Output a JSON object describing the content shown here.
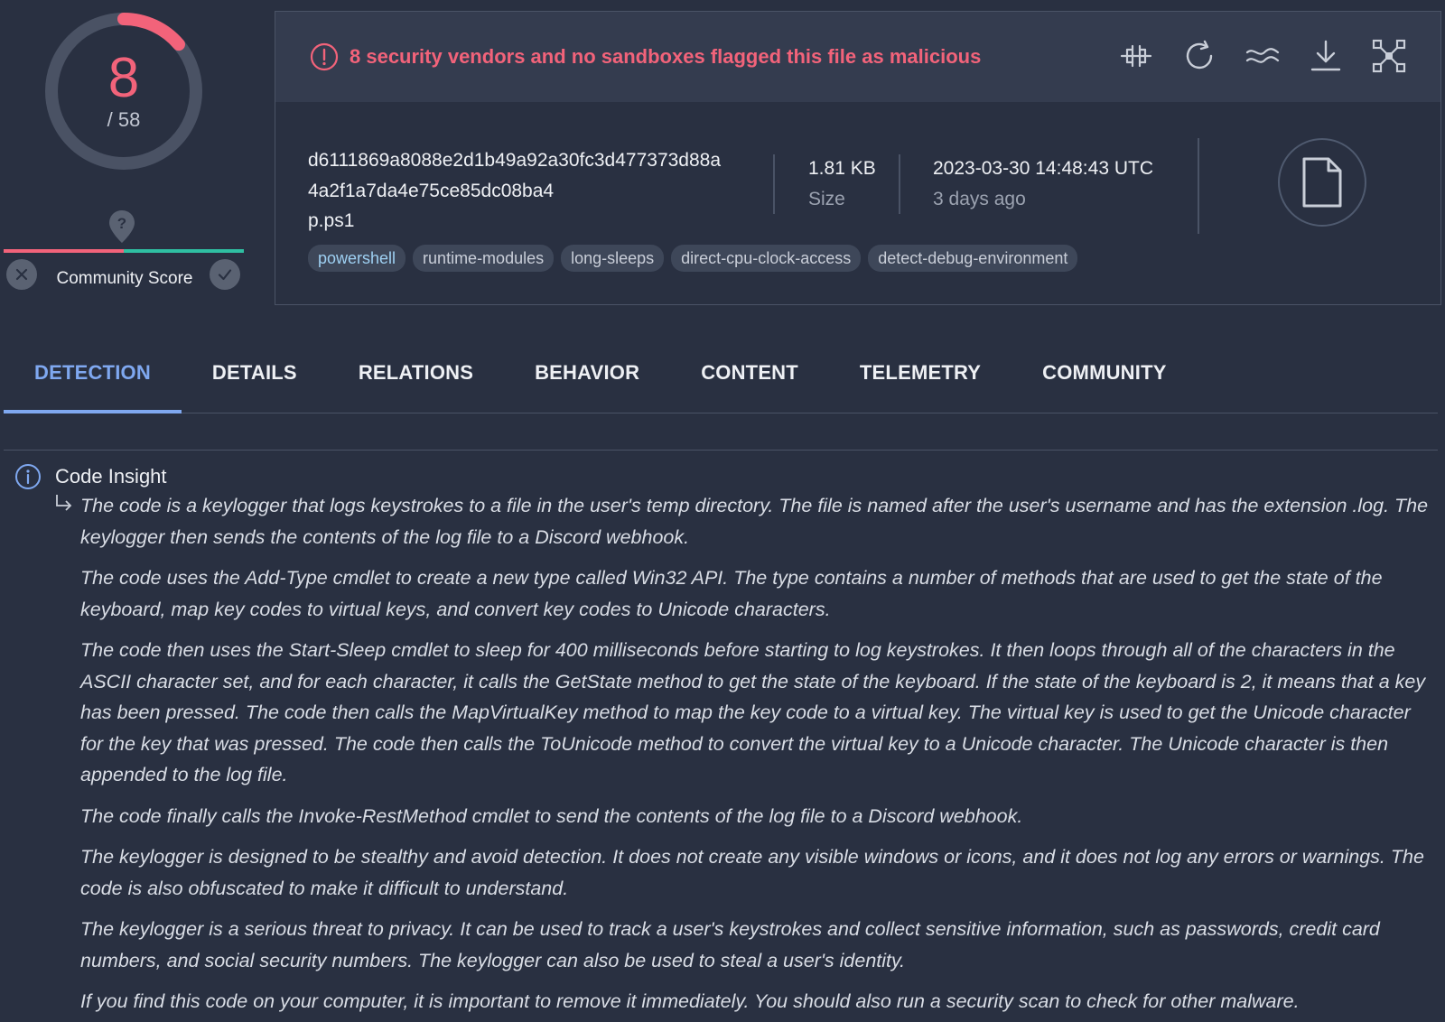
{
  "score": {
    "detections": "8",
    "total": "/ 58",
    "community_label": "Community Score",
    "colors": {
      "malicious": "#f2637a",
      "harmless": "#2fbfa2"
    }
  },
  "banner": {
    "text": "8 security vendors and no sandboxes flagged this file as malicious",
    "actions": [
      "compare-icon",
      "reanalyze-icon",
      "similar-icon",
      "download-icon",
      "graph-icon"
    ]
  },
  "file": {
    "hash_line1": "d6111869a8088e2d1b49a92a30fc3d477373d88a",
    "hash_line2": "4a2f1a7da4e75ce85dc08ba4",
    "name": "p.ps1",
    "size_value": "1.81 KB",
    "size_label": "Size",
    "date_value": "2023-03-30 14:48:43 UTC",
    "date_relative": "3 days ago",
    "tags": [
      "powershell",
      "runtime-modules",
      "long-sleeps",
      "direct-cpu-clock-access",
      "detect-debug-environment"
    ]
  },
  "tabs": [
    "DETECTION",
    "DETAILS",
    "RELATIONS",
    "BEHAVIOR",
    "CONTENT",
    "TELEMETRY",
    "COMMUNITY"
  ],
  "code_insight": {
    "title": "Code Insight",
    "paragraphs": [
      "The code is a keylogger that logs keystrokes to a file in the user's temp directory. The file is named after the user's username and has the extension .log. The keylogger then sends the contents of the log file to a Discord webhook.",
      "The code uses the Add-Type cmdlet to create a new type called Win32 API. The type contains a number of methods that are used to get the state of the keyboard, map key codes to virtual keys, and convert key codes to Unicode characters.",
      "The code then uses the Start-Sleep cmdlet to sleep for 400 milliseconds before starting to log keystrokes. It then loops through all of the characters in the ASCII character set, and for each character, it calls the GetState method to get the state of the keyboard. If the state of the keyboard is 2, it means that a key has been pressed. The code then calls the MapVirtualKey method to map the key code to a virtual key. The virtual key is used to get the Unicode character for the key that was pressed. The code then calls the ToUnicode method to convert the virtual key to a Unicode character. The Unicode character is then appended to the log file.",
      "The code finally calls the Invoke-RestMethod cmdlet to send the contents of the log file to a Discord webhook.",
      "The keylogger is designed to be stealthy and avoid detection. It does not create any visible windows or icons, and it does not log any errors or warnings. The code is also obfuscated to make it difficult to understand.",
      "The keylogger is a serious threat to privacy. It can be used to track a user's keystrokes and collect sensitive information, such as passwords, credit card numbers, and social security numbers. The keylogger can also be used to steal a user's identity.",
      "If you find this code on your computer, it is important to remove it immediately. You should also run a security scan to check for other malware."
    ]
  }
}
